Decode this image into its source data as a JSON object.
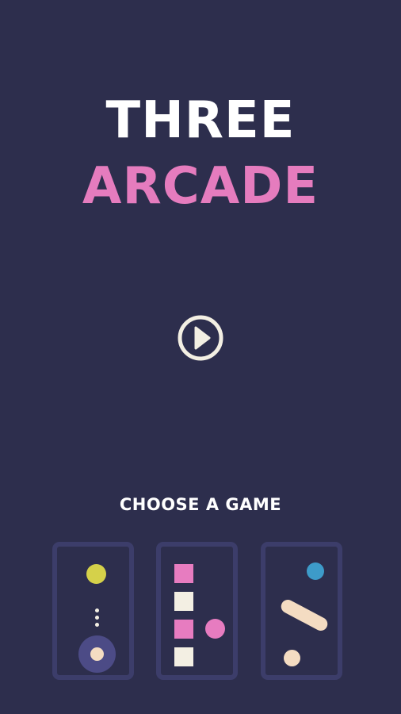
{
  "title": {
    "line1": "THREE",
    "line2": "ARCADE"
  },
  "play_button": {
    "icon": "play-icon"
  },
  "game_chooser": {
    "label": "CHOOSE A GAME",
    "games": [
      {
        "icon": "ball-launch-game-icon"
      },
      {
        "icon": "block-stack-game-icon"
      },
      {
        "icon": "paddle-bounce-game-icon"
      }
    ]
  },
  "colors": {
    "background": "#2d2e4d",
    "title_white": "#ffffff",
    "title_pink": "#e57cbe",
    "cream": "#f3efe3",
    "card_border": "#3c3d6a",
    "yellow": "#d5d14a",
    "ring": "#4c4b86",
    "pink": "#e77cc0",
    "peach": "#f4dcc2",
    "blue": "#3d9bc9"
  }
}
